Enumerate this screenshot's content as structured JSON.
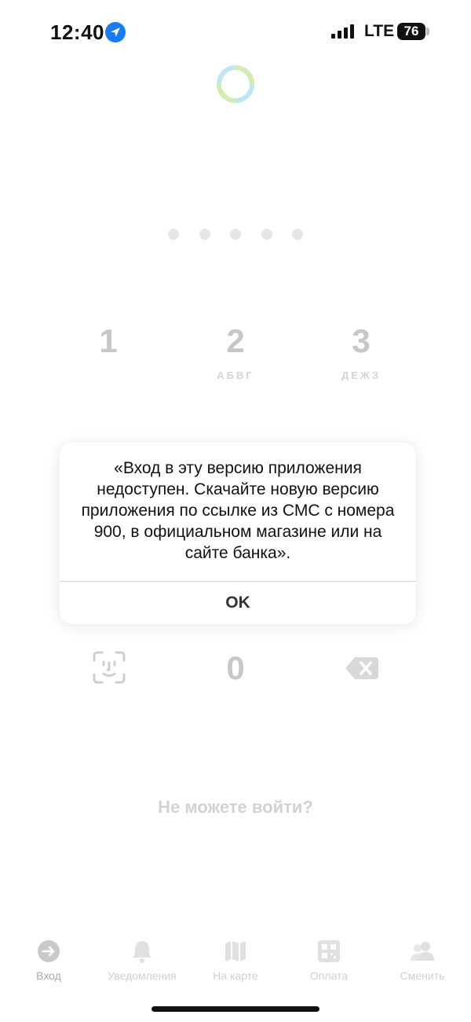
{
  "status_bar": {
    "time": "12:40",
    "network": "LTE",
    "battery": "76"
  },
  "pin": {
    "dot_count": 5
  },
  "keypad": {
    "keys": [
      {
        "num": "1",
        "letters": ""
      },
      {
        "num": "2",
        "letters": "АБВГ"
      },
      {
        "num": "3",
        "letters": "ДЕЖЗ"
      },
      {
        "num": "0",
        "letters": ""
      }
    ],
    "faceid_icon": "face-id-icon",
    "backspace_icon": "backspace-icon"
  },
  "alert": {
    "message": "«Вход в эту версию приложения недоступен. Скачайте новую версию приложения по ссылке из СМС с номера 900, в официальном магазине или на сайте банка».",
    "ok_label": "OK"
  },
  "help_link": "Не можете войти?",
  "tabs": [
    {
      "label": "Вход",
      "icon": "login-arrow-icon",
      "active": true
    },
    {
      "label": "Уведомления",
      "icon": "bell-icon",
      "active": false
    },
    {
      "label": "На карте",
      "icon": "map-icon",
      "active": false
    },
    {
      "label": "Оплата",
      "icon": "qr-icon",
      "active": false
    },
    {
      "label": "Сменить",
      "icon": "users-icon",
      "active": false
    }
  ],
  "colors": {
    "location_badge": "#1a7cf3",
    "spinner_green": "#d6ebb0",
    "spinner_blue": "#bfe6ee"
  }
}
